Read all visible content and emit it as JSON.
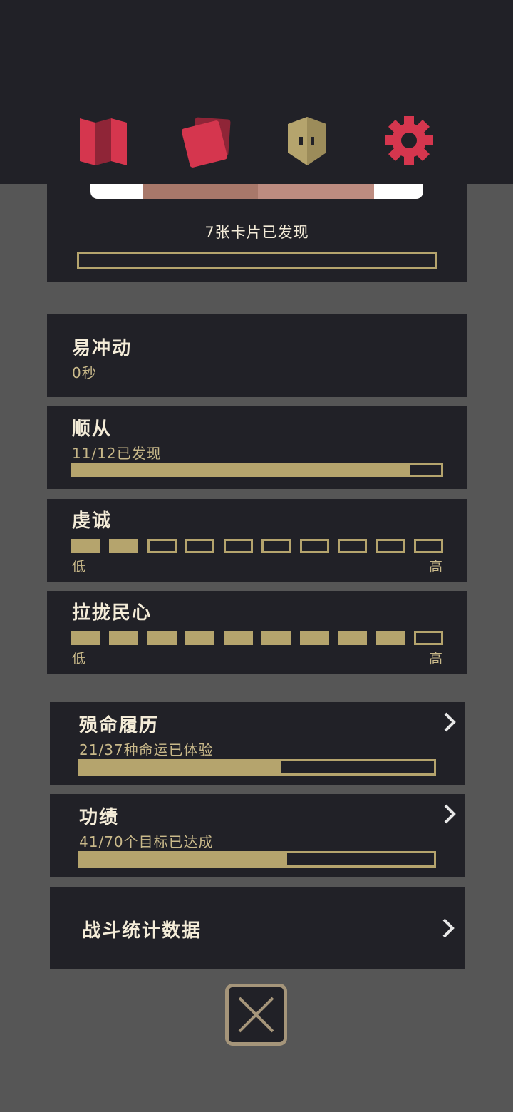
{
  "nav": {
    "items": [
      {
        "name": "map-icon"
      },
      {
        "name": "cards-icon"
      },
      {
        "name": "mask-icon"
      },
      {
        "name": "gear-icon"
      }
    ]
  },
  "cards_panel": {
    "label": "7张卡片已发现",
    "progress": 0.0
  },
  "traits": [
    {
      "title": "易冲动",
      "sub": "0秒"
    },
    {
      "title": "顺从",
      "sub": "11/12已发现",
      "progress": 0.9167
    },
    {
      "title": "虔诚",
      "level": 2,
      "max": 10,
      "low": "低",
      "high": "高"
    },
    {
      "title": "拉拢民心",
      "level": 9,
      "max": 10,
      "low": "低",
      "high": "高"
    }
  ],
  "links": [
    {
      "title": "殒命履历",
      "sub": "21/37种命运已体验",
      "progress": 0.5676
    },
    {
      "title": "功绩",
      "sub": "41/70个目标已达成",
      "progress": 0.5857
    },
    {
      "title": "战斗统计数据"
    }
  ],
  "colors": {
    "accent": "#d5364e",
    "gold": "#b5a46d",
    "panel": "#212127",
    "background": "#565656"
  }
}
